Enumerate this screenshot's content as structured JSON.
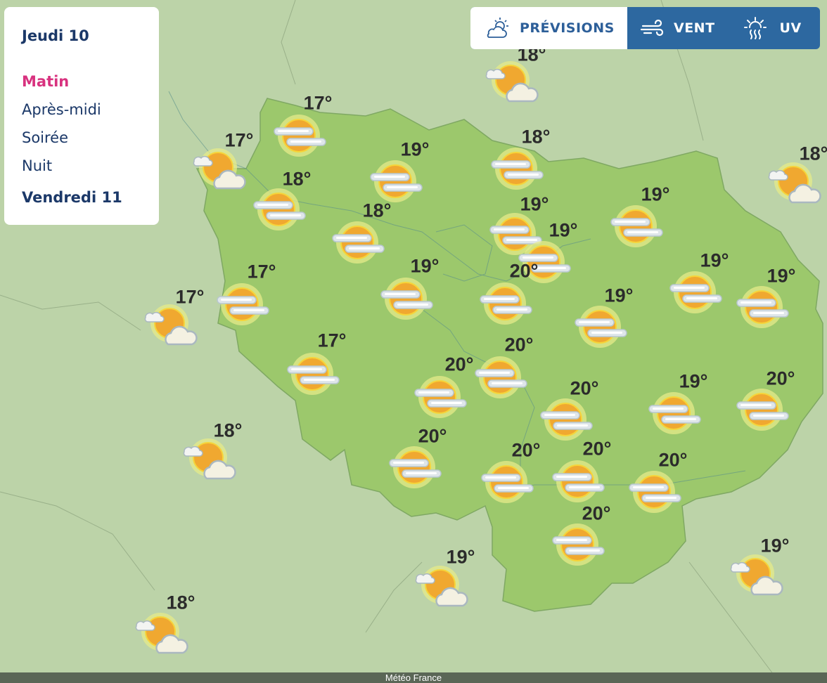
{
  "panel": {
    "day1": "Jeudi 10",
    "slots": [
      {
        "label": "Matin",
        "active": true
      },
      {
        "label": "Après-midi",
        "active": false
      },
      {
        "label": "Soirée",
        "active": false
      },
      {
        "label": "Nuit",
        "active": false
      }
    ],
    "day2": "Vendredi 11"
  },
  "toolbar": {
    "tabs": [
      {
        "label": "PRÉVISIONS",
        "icon": "sun-cloud-icon",
        "active": true
      },
      {
        "label": "VENT",
        "icon": "wind-icon",
        "active": false
      },
      {
        "label": "UV",
        "icon": "uv-icon",
        "active": false
      }
    ]
  },
  "colors": {
    "accent": "#d8327f",
    "nav": "#2d68a0",
    "region": "#9cc86c",
    "background": "#bcd3a8",
    "sun": "#f0a830"
  },
  "markers": [
    {
      "temp": "17°",
      "icon": "haze-sun"
    },
    {
      "temp": "19°",
      "icon": "haze-sun"
    },
    {
      "temp": "18°",
      "icon": "haze-sun"
    },
    {
      "temp": "18°",
      "icon": "haze-sun"
    },
    {
      "temp": "18°",
      "icon": "haze-sun"
    },
    {
      "temp": "19°",
      "icon": "haze-sun"
    },
    {
      "temp": "19°",
      "icon": "haze-sun"
    },
    {
      "temp": "19°",
      "icon": "haze-sun"
    },
    {
      "temp": "17°",
      "icon": "haze-sun"
    },
    {
      "temp": "19°",
      "icon": "haze-sun"
    },
    {
      "temp": "20°",
      "icon": "haze-sun"
    },
    {
      "temp": "19°",
      "icon": "haze-sun"
    },
    {
      "temp": "19°",
      "icon": "haze-sun"
    },
    {
      "temp": "19°",
      "icon": "haze-sun"
    },
    {
      "temp": "17°",
      "icon": "haze-sun"
    },
    {
      "temp": "20°",
      "icon": "haze-sun"
    },
    {
      "temp": "20°",
      "icon": "haze-sun"
    },
    {
      "temp": "20°",
      "icon": "haze-sun"
    },
    {
      "temp": "19°",
      "icon": "haze-sun"
    },
    {
      "temp": "20°",
      "icon": "haze-sun"
    },
    {
      "temp": "20°",
      "icon": "haze-sun"
    },
    {
      "temp": "20°",
      "icon": "haze-sun"
    },
    {
      "temp": "20°",
      "icon": "haze-sun"
    },
    {
      "temp": "20°",
      "icon": "haze-sun"
    },
    {
      "temp": "20°",
      "icon": "haze-sun"
    },
    {
      "temp": "18°",
      "icon": "sun-cloud"
    },
    {
      "temp": "17°",
      "icon": "sun-cloud"
    },
    {
      "temp": "17°",
      "icon": "sun-cloud"
    },
    {
      "temp": "18°",
      "icon": "sun-cloud"
    },
    {
      "temp": "18°",
      "icon": "sun-cloud"
    },
    {
      "temp": "19°",
      "icon": "sun-cloud"
    },
    {
      "temp": "19°",
      "icon": "sun-cloud"
    },
    {
      "temp": "18°",
      "icon": "sun-cloud"
    }
  ],
  "footer": "Météo France"
}
